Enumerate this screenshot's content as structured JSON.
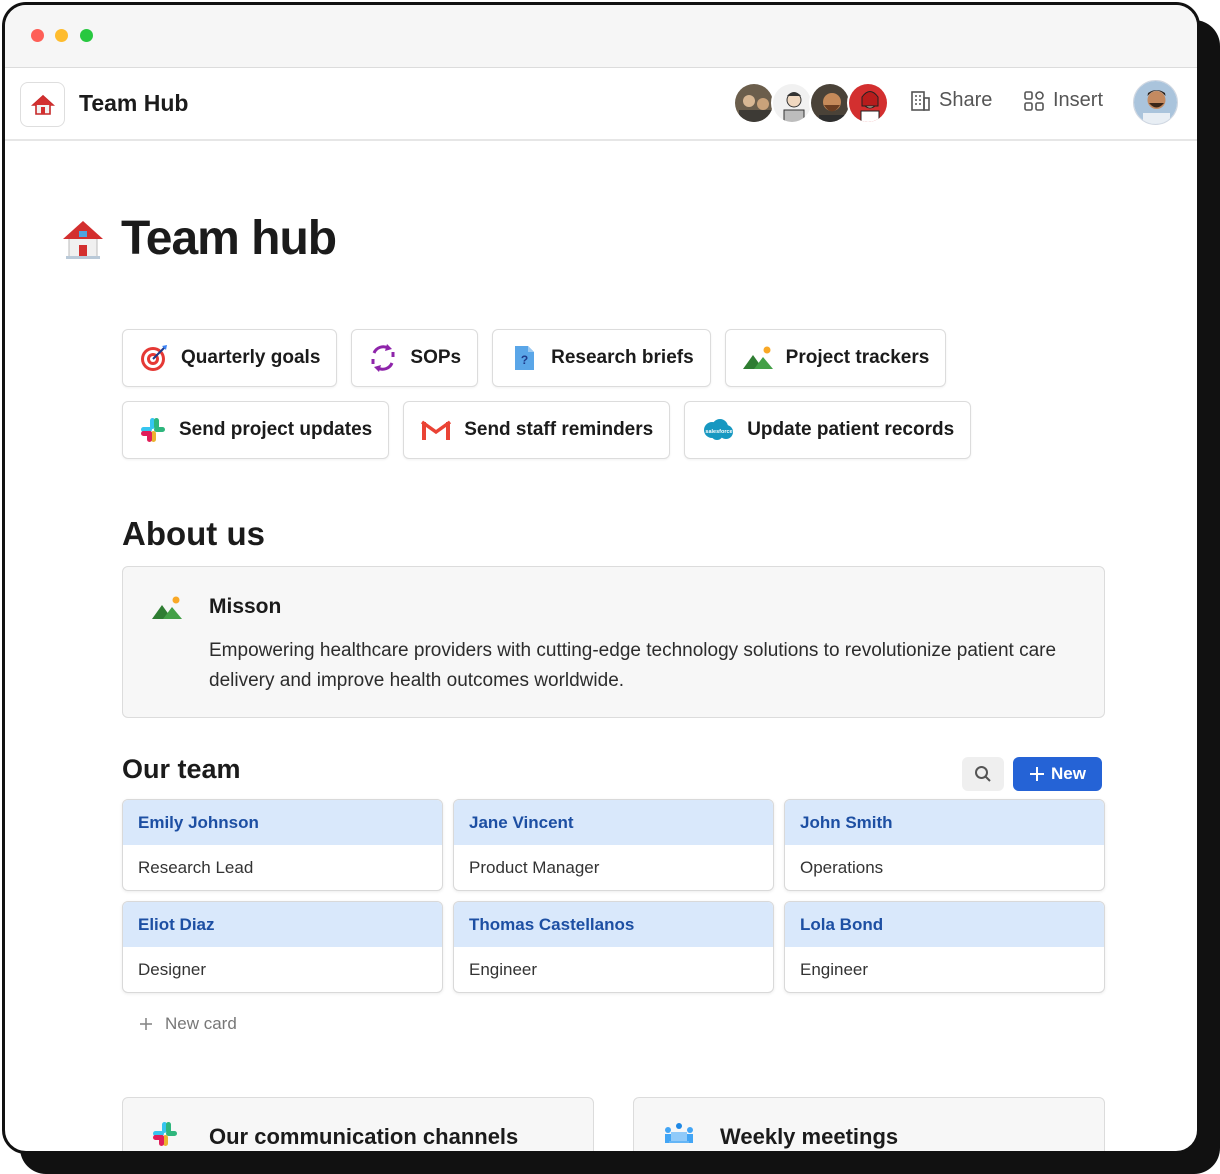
{
  "header": {
    "app_title": "Team Hub",
    "share_label": "Share",
    "insert_label": "Insert"
  },
  "page": {
    "title": "Team hub"
  },
  "quick_links": [
    {
      "label": "Quarterly goals",
      "icon": "target-icon"
    },
    {
      "label": "SOPs",
      "icon": "cycle-arrows-icon"
    },
    {
      "label": "Research briefs",
      "icon": "document-question-icon"
    },
    {
      "label": "Project trackers",
      "icon": "mountain-sun-icon"
    },
    {
      "label": "Send project updates",
      "icon": "slack-icon"
    },
    {
      "label": "Send staff reminders",
      "icon": "gmail-icon"
    },
    {
      "label": "Update patient records",
      "icon": "salesforce-icon"
    }
  ],
  "about": {
    "heading": "About us",
    "mission_title": "Misson",
    "mission_text": "Empowering healthcare providers with cutting-edge technology solutions to revolutionize patient care delivery and improve health outcomes worldwide."
  },
  "team": {
    "heading": "Our team",
    "new_label": "New",
    "new_card_label": "New card",
    "members": [
      {
        "name": "Emily Johnson",
        "role": "Research Lead"
      },
      {
        "name": "Jane Vincent",
        "role": "Product Manager"
      },
      {
        "name": "John Smith",
        "role": "Operations"
      },
      {
        "name": "Eliot Diaz",
        "role": "Designer"
      },
      {
        "name": "Thomas Castellanos",
        "role": "Engineer"
      },
      {
        "name": "Lola Bond",
        "role": "Engineer"
      }
    ]
  },
  "sections": {
    "channels_title": "Our communication channels",
    "meetings_title": "Weekly meetings"
  },
  "colors": {
    "accent": "#2563d6",
    "card_header_bg": "#d9e8fb",
    "card_name": "#1d4fa3"
  }
}
